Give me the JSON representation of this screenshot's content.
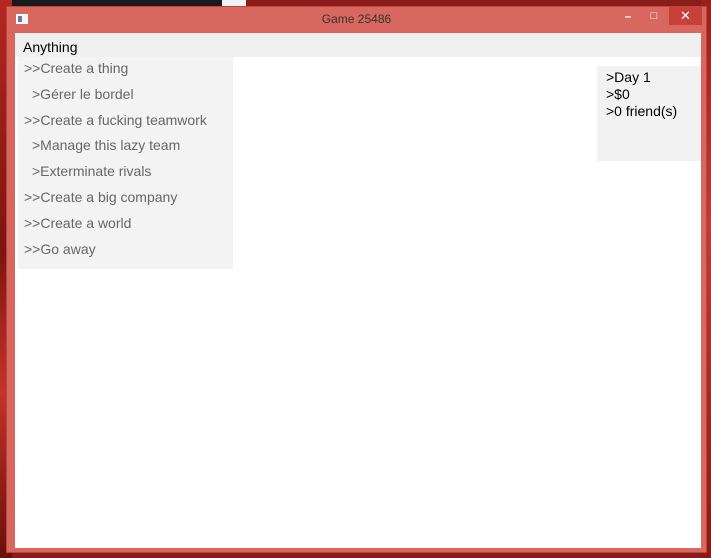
{
  "window": {
    "title": "Game 25486",
    "controls": {
      "minimize": "–",
      "maximize": "□",
      "close": "✕"
    }
  },
  "menubar": {
    "menu_label": "Anything"
  },
  "actions": [
    {
      "label": ">>Create a thing"
    },
    {
      "label": ">Gérer le bordel"
    },
    {
      "label": ">>Create a fucking teamwork"
    },
    {
      "label": ">Manage this lazy team"
    },
    {
      "label": ">Exterminate rivals"
    },
    {
      "label": ">>Create a big company"
    },
    {
      "label": ">>Create a world"
    },
    {
      "label": ">>Go away"
    }
  ],
  "stats": {
    "day": ">Day 1",
    "money": ">$0",
    "friends": ">0 friend(s)"
  },
  "colors": {
    "window_frame": "#d8685f",
    "close_button": "#c8403a",
    "panel_bg": "#f3f3f3",
    "action_text": "#666666"
  }
}
